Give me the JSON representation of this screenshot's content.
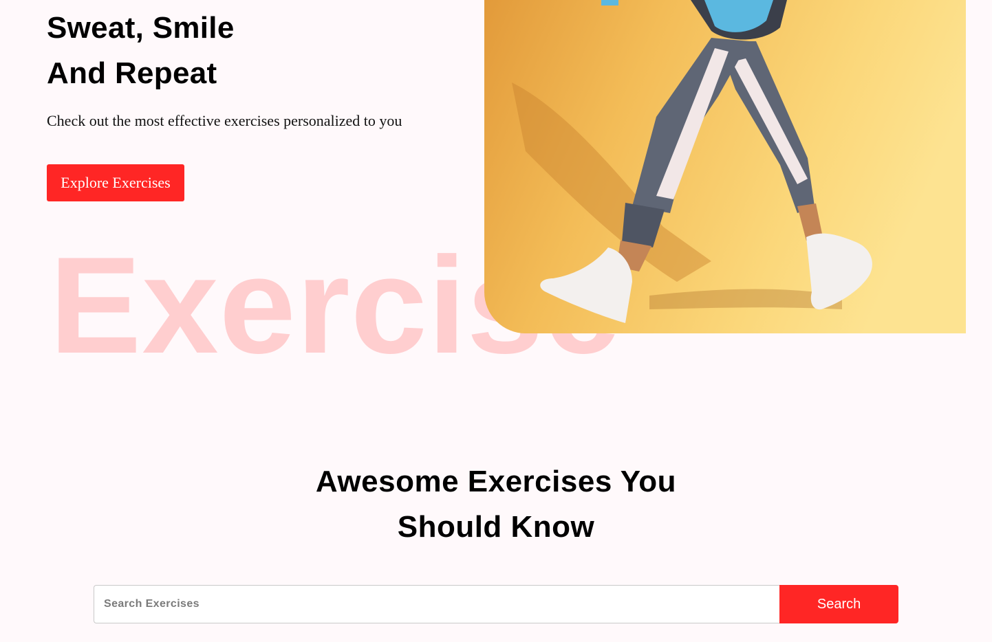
{
  "hero": {
    "title_line1": "Sweat, Smile",
    "title_line2": "And Repeat",
    "subtitle": "Check out the most effective exercises personalized to you",
    "cta_label": "Explore Exercises",
    "watermark": "Exercise"
  },
  "banner": {
    "image_alt": "Person walking in leggings and sneakers carrying a gym bag",
    "background_color": "#f6c15b"
  },
  "section": {
    "title_line1": "Awesome Exercises You",
    "title_line2": "Should Know"
  },
  "search": {
    "placeholder": "Search Exercises",
    "value": "",
    "button_label": "Search"
  },
  "colors": {
    "accent": "#ff2625",
    "page_background": "#fff9fb",
    "watermark_tint": "#ffd6d6"
  }
}
